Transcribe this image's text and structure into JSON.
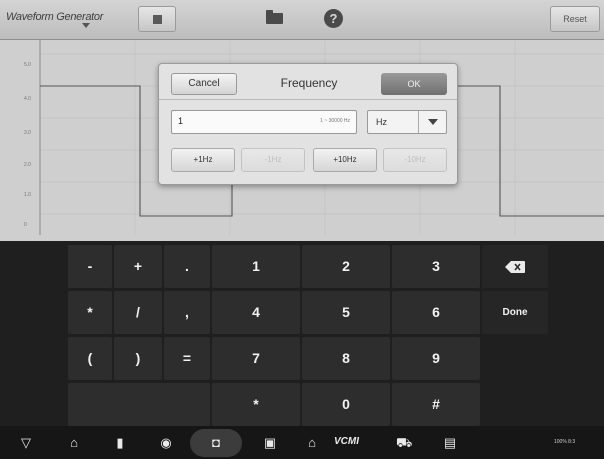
{
  "toolbar": {
    "title": "Waveform Generator",
    "reset_label": "Reset"
  },
  "graph": {
    "y_ticks": [
      "5.0",
      "4.0",
      "3.0",
      "2.0",
      "1.0",
      "0"
    ]
  },
  "dialog": {
    "title": "Frequency",
    "cancel_label": "Cancel",
    "ok_label": "OK",
    "input_value": "1",
    "input_range": "1 ~ 30000 Hz",
    "unit_value": "Hz",
    "step_buttons": [
      {
        "label": "+1Hz",
        "enabled": true
      },
      {
        "label": "-1Hz",
        "enabled": false
      },
      {
        "label": "+10Hz",
        "enabled": true
      },
      {
        "label": "-10Hz",
        "enabled": false
      }
    ]
  },
  "keypad": {
    "symbols_row1": [
      "-",
      "+",
      "."
    ],
    "symbols_row2": [
      "*",
      "/",
      ","
    ],
    "symbols_row3": [
      "(",
      ")",
      "="
    ],
    "digits": [
      "1",
      "2",
      "3",
      "4",
      "5",
      "6",
      "7",
      "8",
      "9",
      "*",
      "0",
      "#"
    ],
    "done_label": "Done",
    "backspace_icon": "backspace-icon"
  },
  "navbar": {
    "icons": [
      "back-icon",
      "home-icon",
      "recent-apps-icon",
      "browser-icon",
      "camera-icon",
      "screen-record-icon",
      "home-garage-icon",
      "vcmi-icon",
      "car-icon",
      "scanner-icon"
    ],
    "vcmi_label": "VCMI",
    "status": "100% 8:3"
  }
}
